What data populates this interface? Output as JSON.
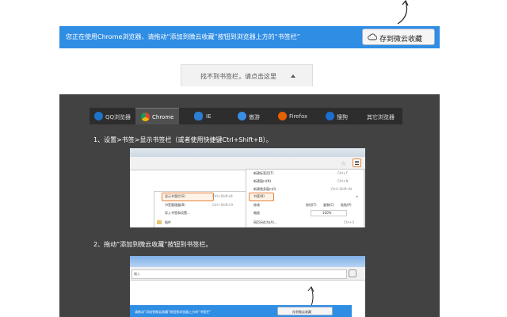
{
  "banner": {
    "text": "您正在使用Chrome浏览器，请拖动“添加到微云收藏”按钮到浏览器上方的“书签栏”",
    "button_label": "存到微云收藏"
  },
  "toggle": {
    "label": "找不到书签栏，请点击这里"
  },
  "browser_tabs": [
    {
      "label": "QQ浏览器",
      "icon": "qq-browser-icon"
    },
    {
      "label": "Chrome",
      "icon": "chrome-icon"
    },
    {
      "label": "IE",
      "icon": "ie-icon"
    },
    {
      "label": "傲游",
      "icon": "maxthon-icon"
    },
    {
      "label": "Firefox",
      "icon": "firefox-icon"
    },
    {
      "label": "搜狗",
      "icon": "sogou-icon"
    },
    {
      "label": "其它浏览器",
      "icon": ""
    }
  ],
  "active_tab": "Chrome",
  "steps": {
    "step1": "1、设置>书签>显示书签栏（或者使用快捷键Ctrl+Shift+B）。",
    "step2": "2、拖动“添加到微云收藏”按钮到书签栏。"
  },
  "screenshot1": {
    "submenu": [
      {
        "label": "显示书签栏(S)",
        "shortcut": "Ctrl+Shift+B"
      },
      {
        "label": "书签管理器(B)",
        "shortcut": "Ctrl+Shift+O"
      },
      {
        "label": "导入书签和设置...",
        "shortcut": ""
      },
      {
        "label": "插件",
        "shortcut": ""
      }
    ],
    "menu": [
      {
        "label": "新建标签页(T)",
        "shortcut": "Ctrl+T"
      },
      {
        "label": "新建窗口(N)",
        "shortcut": "Ctrl+N"
      },
      {
        "label": "新建隐身窗口(I)",
        "shortcut": "Ctrl+Shift+N"
      },
      {
        "label": "书签(B)",
        "shortcut": ""
      },
      {
        "label": "修改",
        "shortcut": ""
      },
      {
        "label": "缩放",
        "shortcut": ""
      },
      {
        "label": "网页另存为(A)...",
        "shortcut": "Ctrl+S"
      }
    ],
    "edit_items": [
      "剪切(T)",
      "复制(C)",
      "粘贴(P)"
    ],
    "zoom_value": "100%"
  },
  "screenshot2": {
    "address_hint": "输入",
    "banner_text": "请拖动“添加到微云收藏”按钮到浏览器上方的“书签栏”",
    "button_label": "存到微云收藏"
  },
  "colors": {
    "banner_blue": "#2f8de4",
    "dark_bg": "#424242",
    "tabs_bg": "#2d2d2d",
    "highlight_orange": "#e8823a"
  }
}
